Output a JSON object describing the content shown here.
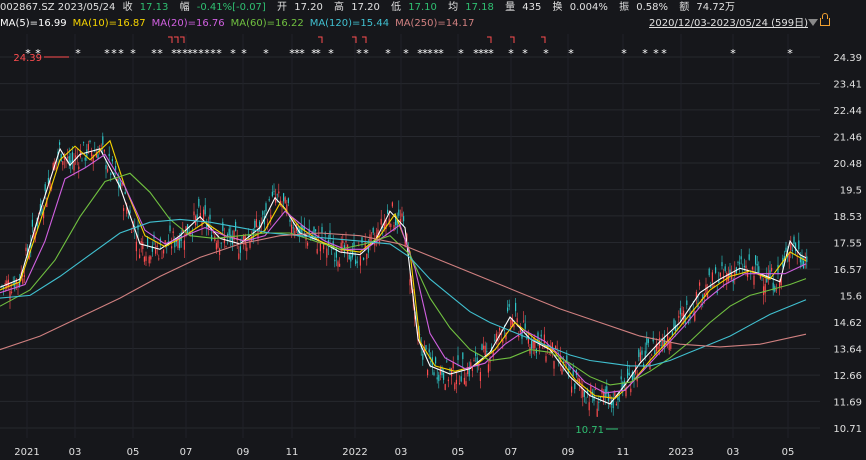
{
  "header": {
    "code_date": "002867.SZ 2023/05/24",
    "close_label": "收",
    "close": "17.13",
    "change_label": "幅",
    "change": "-0.41%[-0.07]",
    "open_label": "开",
    "open": "17.20",
    "high_label": "高",
    "high": "17.20",
    "low_label": "低",
    "low": "17.10",
    "avg_label": "均",
    "avg": "17.18",
    "volume_label": "量",
    "volume": "435",
    "turnover_label": "换",
    "turnover": "0.004%",
    "amplitude_label": "振",
    "amplitude": "0.58%",
    "amount_label": "额",
    "amount": "74.72万"
  },
  "range_label": "2020/12/03-2023/05/24 (599日)",
  "colors": {
    "background": "#16171b",
    "up_candle": "#ff4d4f",
    "down_candle": "#2ec7c9",
    "marker": "#ffffff",
    "flag": "#ff4d4f"
  },
  "chart_data": {
    "type": "candlestick",
    "title": "",
    "y_axis": {
      "min": 10.71,
      "max": 24.39,
      "ticks": [
        "24.39",
        "23.41",
        "22.44",
        "21.46",
        "20.48",
        "19.5",
        "18.53",
        "17.55",
        "16.57",
        "15.6",
        "14.62",
        "13.64",
        "12.66",
        "11.69",
        "10.71"
      ]
    },
    "x_axis": {
      "ticks": [
        "2021",
        "03",
        "05",
        "07",
        "09",
        "11",
        "2022",
        "03",
        "05",
        "07",
        "09",
        "11",
        "2023",
        "03",
        "05"
      ]
    },
    "annotations": {
      "max_label": "24.39",
      "min_label": "10.71"
    },
    "ma_series": [
      {
        "name": "MA(5)",
        "value": "16.99",
        "color": "#ffffff",
        "points": [
          [
            0,
            15.9
          ],
          [
            20,
            16.2
          ],
          [
            40,
            18.7
          ],
          [
            60,
            21.0
          ],
          [
            70,
            20.4
          ],
          [
            80,
            20.8
          ],
          [
            100,
            21.0
          ],
          [
            120,
            19.6
          ],
          [
            140,
            17.5
          ],
          [
            160,
            17.3
          ],
          [
            180,
            17.8
          ],
          [
            200,
            18.5
          ],
          [
            220,
            17.7
          ],
          [
            240,
            17.5
          ],
          [
            260,
            18.1
          ],
          [
            275,
            19.2
          ],
          [
            285,
            18.8
          ],
          [
            300,
            17.9
          ],
          [
            320,
            17.6
          ],
          [
            340,
            17.2
          ],
          [
            360,
            17.1
          ],
          [
            375,
            17.6
          ],
          [
            390,
            18.7
          ],
          [
            405,
            18.1
          ],
          [
            418,
            14.0
          ],
          [
            430,
            13.0
          ],
          [
            450,
            12.7
          ],
          [
            470,
            12.9
          ],
          [
            490,
            13.5
          ],
          [
            510,
            14.8
          ],
          [
            530,
            14.0
          ],
          [
            550,
            13.6
          ],
          [
            570,
            12.6
          ],
          [
            590,
            11.9
          ],
          [
            610,
            11.6
          ],
          [
            625,
            12.3
          ],
          [
            640,
            13.1
          ],
          [
            660,
            13.9
          ],
          [
            680,
            14.6
          ],
          [
            700,
            15.7
          ],
          [
            720,
            16.2
          ],
          [
            740,
            16.6
          ],
          [
            760,
            16.4
          ],
          [
            780,
            16.1
          ],
          [
            790,
            17.6
          ],
          [
            800,
            17.1
          ],
          [
            806,
            16.99
          ]
        ]
      },
      {
        "name": "MA(10)",
        "value": "16.87",
        "color": "#f5d300",
        "points": [
          [
            0,
            15.8
          ],
          [
            20,
            16.1
          ],
          [
            40,
            18.3
          ],
          [
            60,
            20.6
          ],
          [
            75,
            21.1
          ],
          [
            90,
            20.6
          ],
          [
            110,
            21.3
          ],
          [
            125,
            19.6
          ],
          [
            145,
            17.8
          ],
          [
            165,
            17.4
          ],
          [
            185,
            17.8
          ],
          [
            205,
            18.3
          ],
          [
            225,
            17.8
          ],
          [
            245,
            17.6
          ],
          [
            265,
            18.0
          ],
          [
            280,
            19.0
          ],
          [
            300,
            18.1
          ],
          [
            320,
            17.6
          ],
          [
            340,
            17.3
          ],
          [
            360,
            17.2
          ],
          [
            380,
            17.8
          ],
          [
            395,
            18.6
          ],
          [
            410,
            17.2
          ],
          [
            420,
            13.9
          ],
          [
            435,
            13.0
          ],
          [
            455,
            12.8
          ],
          [
            475,
            13.0
          ],
          [
            495,
            13.6
          ],
          [
            515,
            14.6
          ],
          [
            535,
            14.0
          ],
          [
            555,
            13.5
          ],
          [
            575,
            12.5
          ],
          [
            595,
            11.9
          ],
          [
            615,
            11.8
          ],
          [
            630,
            12.3
          ],
          [
            650,
            13.2
          ],
          [
            670,
            14.0
          ],
          [
            690,
            14.9
          ],
          [
            710,
            15.8
          ],
          [
            730,
            16.3
          ],
          [
            750,
            16.5
          ],
          [
            770,
            16.2
          ],
          [
            790,
            17.2
          ],
          [
            806,
            16.87
          ]
        ]
      },
      {
        "name": "MA(20)",
        "value": "16.76",
        "color": "#d060e0",
        "points": [
          [
            0,
            15.7
          ],
          [
            25,
            16.0
          ],
          [
            45,
            17.6
          ],
          [
            65,
            19.9
          ],
          [
            85,
            20.3
          ],
          [
            105,
            20.8
          ],
          [
            125,
            19.6
          ],
          [
            145,
            18.0
          ],
          [
            165,
            17.5
          ],
          [
            185,
            17.8
          ],
          [
            205,
            18.1
          ],
          [
            225,
            17.8
          ],
          [
            245,
            17.6
          ],
          [
            265,
            17.8
          ],
          [
            285,
            18.7
          ],
          [
            305,
            18.1
          ],
          [
            325,
            17.6
          ],
          [
            345,
            17.3
          ],
          [
            365,
            17.3
          ],
          [
            385,
            17.8
          ],
          [
            400,
            18.2
          ],
          [
            415,
            16.6
          ],
          [
            430,
            14.2
          ],
          [
            445,
            13.3
          ],
          [
            465,
            12.9
          ],
          [
            485,
            13.1
          ],
          [
            505,
            13.8
          ],
          [
            525,
            14.3
          ],
          [
            545,
            13.9
          ],
          [
            565,
            13.2
          ],
          [
            585,
            12.4
          ],
          [
            605,
            12.0
          ],
          [
            625,
            12.1
          ],
          [
            645,
            12.9
          ],
          [
            665,
            13.7
          ],
          [
            685,
            14.5
          ],
          [
            705,
            15.4
          ],
          [
            725,
            16.0
          ],
          [
            745,
            16.4
          ],
          [
            765,
            16.4
          ],
          [
            785,
            16.4
          ],
          [
            806,
            16.76
          ]
        ]
      },
      {
        "name": "MA(60)",
        "value": "16.22",
        "color": "#70c040",
        "points": [
          [
            0,
            15.2
          ],
          [
            30,
            15.8
          ],
          [
            55,
            16.9
          ],
          [
            80,
            18.5
          ],
          [
            105,
            19.8
          ],
          [
            130,
            20.1
          ],
          [
            150,
            19.4
          ],
          [
            170,
            18.4
          ],
          [
            190,
            17.8
          ],
          [
            215,
            17.7
          ],
          [
            240,
            17.8
          ],
          [
            265,
            17.9
          ],
          [
            290,
            17.9
          ],
          [
            315,
            17.6
          ],
          [
            340,
            17.3
          ],
          [
            365,
            17.5
          ],
          [
            390,
            17.8
          ],
          [
            410,
            17.1
          ],
          [
            430,
            15.5
          ],
          [
            450,
            14.4
          ],
          [
            470,
            13.6
          ],
          [
            490,
            13.2
          ],
          [
            510,
            13.3
          ],
          [
            530,
            13.6
          ],
          [
            550,
            13.5
          ],
          [
            570,
            13.1
          ],
          [
            590,
            12.6
          ],
          [
            610,
            12.3
          ],
          [
            630,
            12.4
          ],
          [
            650,
            12.8
          ],
          [
            670,
            13.3
          ],
          [
            690,
            13.9
          ],
          [
            710,
            14.6
          ],
          [
            730,
            15.2
          ],
          [
            750,
            15.6
          ],
          [
            770,
            15.8
          ],
          [
            790,
            16.0
          ],
          [
            806,
            16.22
          ]
        ]
      },
      {
        "name": "MA(120)",
        "value": "15.44",
        "color": "#40c0d0",
        "points": [
          [
            0,
            15.5
          ],
          [
            30,
            15.6
          ],
          [
            60,
            16.3
          ],
          [
            90,
            17.1
          ],
          [
            120,
            17.9
          ],
          [
            150,
            18.3
          ],
          [
            180,
            18.4
          ],
          [
            210,
            18.3
          ],
          [
            240,
            18.1
          ],
          [
            270,
            17.9
          ],
          [
            300,
            17.8
          ],
          [
            330,
            17.7
          ],
          [
            360,
            17.6
          ],
          [
            390,
            17.5
          ],
          [
            410,
            17.0
          ],
          [
            430,
            16.2
          ],
          [
            450,
            15.6
          ],
          [
            470,
            15.0
          ],
          [
            490,
            14.6
          ],
          [
            510,
            14.3
          ],
          [
            530,
            14.0
          ],
          [
            550,
            13.7
          ],
          [
            570,
            13.4
          ],
          [
            590,
            13.2
          ],
          [
            610,
            13.1
          ],
          [
            630,
            13.0
          ],
          [
            650,
            13.0
          ],
          [
            670,
            13.2
          ],
          [
            690,
            13.5
          ],
          [
            710,
            13.8
          ],
          [
            730,
            14.1
          ],
          [
            750,
            14.5
          ],
          [
            770,
            14.9
          ],
          [
            790,
            15.2
          ],
          [
            806,
            15.44
          ]
        ]
      },
      {
        "name": "MA(250)",
        "value": "14.17",
        "color": "#d08080",
        "points": [
          [
            0,
            13.6
          ],
          [
            40,
            14.1
          ],
          [
            80,
            14.8
          ],
          [
            120,
            15.5
          ],
          [
            160,
            16.3
          ],
          [
            200,
            17.0
          ],
          [
            240,
            17.5
          ],
          [
            280,
            17.8
          ],
          [
            320,
            17.9
          ],
          [
            360,
            17.8
          ],
          [
            400,
            17.5
          ],
          [
            440,
            16.9
          ],
          [
            480,
            16.3
          ],
          [
            520,
            15.7
          ],
          [
            560,
            15.1
          ],
          [
            600,
            14.6
          ],
          [
            640,
            14.1
          ],
          [
            680,
            13.8
          ],
          [
            720,
            13.7
          ],
          [
            760,
            13.8
          ],
          [
            806,
            14.17
          ]
        ]
      }
    ]
  }
}
